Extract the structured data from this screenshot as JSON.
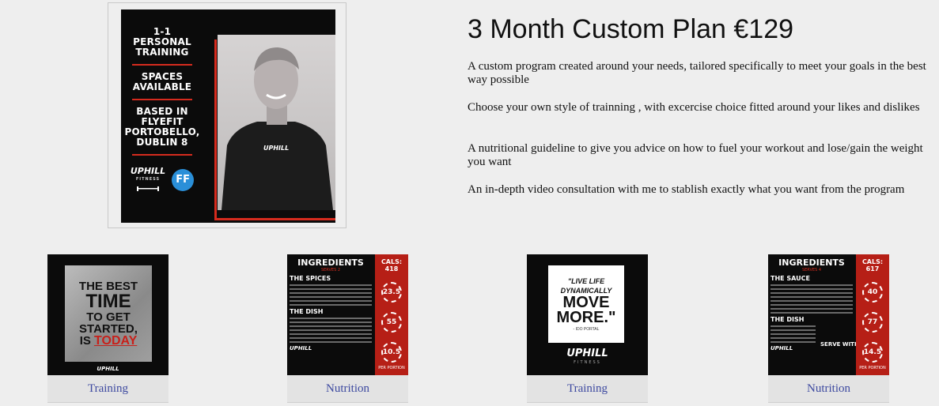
{
  "hero": {
    "block1": [
      "1-1",
      "PERSONAL",
      "TRAINING"
    ],
    "block2": [
      "SPACES",
      "AVAILABLE"
    ],
    "block3": [
      "BASED IN",
      "FLYEFIT",
      "PORTOBELLO,",
      "DUBLIN 8"
    ],
    "brand": "UPHILL",
    "brand_sub": "FITNESS",
    "partner_logo": "FF",
    "shirt_text": "UPHILL"
  },
  "plan": {
    "title": "3 Month Custom Plan €129",
    "paragraphs": [
      "A custom program created around your needs, tailored specifically to meet your goals in the best way possible",
      "Choose your own style of trainning , with excercise choice fitted around your likes and dislikes",
      "A nutritional guideline to give you advice on how to fuel your workout and lose/gain the weight you want",
      "An in-depth video consultation with me to stablish exactly what you want from the program"
    ]
  },
  "cards": [
    {
      "label": "Training",
      "poster": [
        "THE BEST",
        "TIME",
        "TO GET",
        "STARTED,",
        "IS ",
        "TODAY"
      ],
      "brand": "UPHILL"
    },
    {
      "label": "Nutrition",
      "title": "INGREDIENTS",
      "serves": "SERVES 2",
      "head1": "THE SPICES",
      "head2": "THE DISH",
      "cals_label": "CALS:",
      "cals": "418",
      "macros": [
        "23.5",
        "55",
        "10.5"
      ],
      "per_portion": "PER PORTION",
      "brand": "UPHILL"
    },
    {
      "label": "Training",
      "quote_small": "\"LIVE LIFE DYNAMICALLY",
      "quote_big": "MOVE MORE.\"",
      "author": "- IDO PORTAL",
      "brand": "UPHILL",
      "brand_sub": "FITNESS"
    },
    {
      "label": "Nutrition",
      "title": "INGREDIENTS",
      "serves": "SERVES 4",
      "head1": "THE SAUCE",
      "head2": "THE DISH",
      "serve_with": "SERVE WITH",
      "cals_label": "CALS:",
      "cals": "617",
      "macros": [
        "40",
        "77",
        "14.5"
      ],
      "per_portion": "PER PORTION",
      "brand": "UPHILL"
    }
  ],
  "colors": {
    "accent_red": "#d52b1e",
    "link_blue": "#3e4aa0",
    "background": "#eeeeee"
  }
}
